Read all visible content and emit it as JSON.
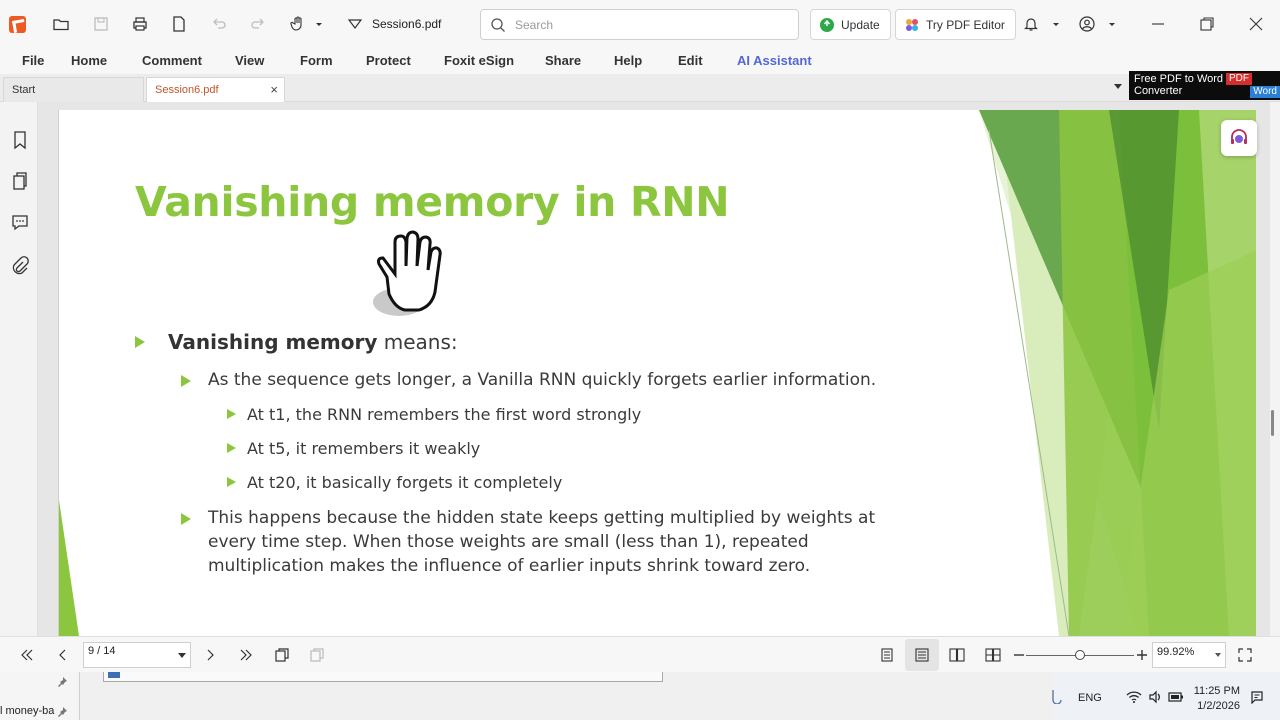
{
  "toolbar": {
    "document_title": "Session6.pdf",
    "search_placeholder": "Search",
    "update_label": "Update",
    "try_editor_label": "Try PDF Editor"
  },
  "menu": {
    "items": [
      "File",
      "Home",
      "Comment",
      "View",
      "Form",
      "Protect",
      "Foxit eSign",
      "Share",
      "Help",
      "Edit",
      "AI Assistant"
    ]
  },
  "tabs": {
    "start_label": "Start",
    "active_label": "Session6.pdf",
    "close_glyph": "×"
  },
  "ad": {
    "line1": "Free PDF to Word",
    "line2": "Converter",
    "pdf_badge": "PDF",
    "word_badge": "Word"
  },
  "slide": {
    "title": "Vanishing memory in RNN",
    "bullet1_bold": "Vanishing memory",
    "bullet1_rest": " means:",
    "bullet2": "As the sequence gets longer, a Vanilla RNN quickly forgets earlier information.",
    "sub1": "At t1, the RNN remembers the first word strongly",
    "sub2": "At t5, it remembers it weakly",
    "sub3": "At t20, it basically forgets it completely",
    "bullet3_line1": "This happens because the hidden state keeps getting multiplied by weights at",
    "bullet3_line2": "every time step. When those weights are small (less than 1), repeated",
    "bullet3_line3": "multiplication makes the influence of earlier inputs shrink toward zero."
  },
  "status": {
    "page_indicator": "9 / 14",
    "zoom_level": "99.92%",
    "zoom_fraction": 0.5
  },
  "taskbar": {
    "left_label": "l money-ba",
    "language": "ENG",
    "time": "11:25 PM",
    "date": "1/2/2026"
  },
  "colors": {
    "accent_green": "#8cc63f",
    "foxit_orange": "#ee5a24",
    "ai_blue": "#5468d4"
  }
}
